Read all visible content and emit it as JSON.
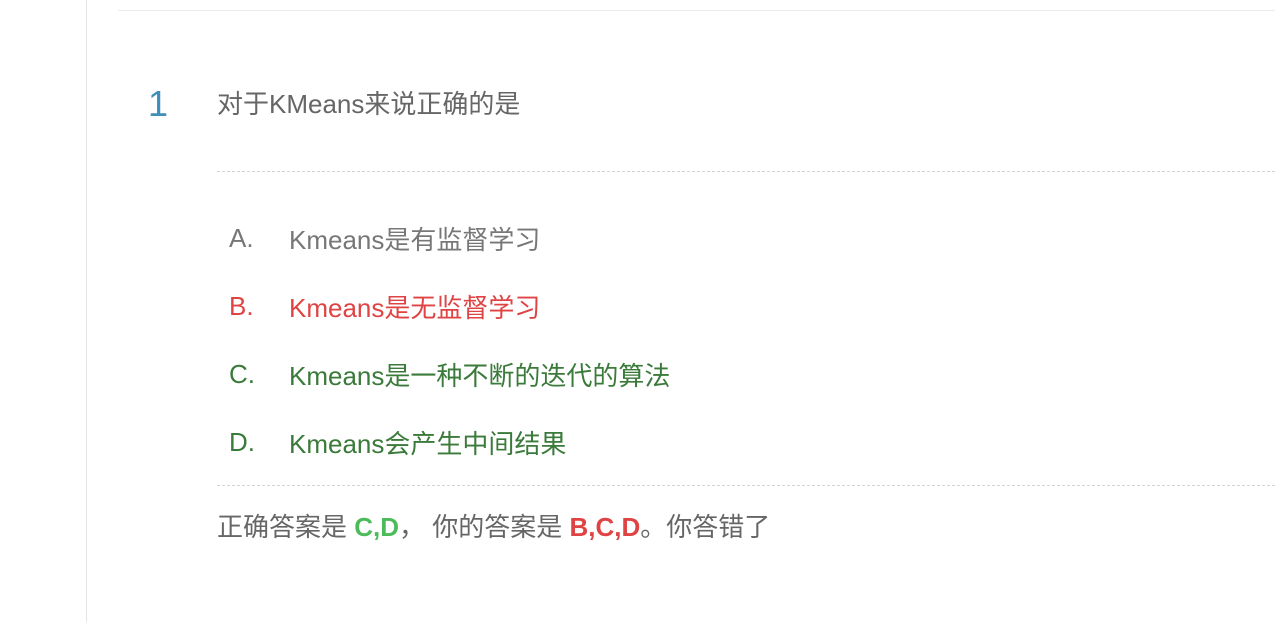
{
  "question": {
    "number": "1",
    "title": "对于KMeans来说正确的是"
  },
  "options": [
    {
      "letter": "A.",
      "text": "Kmeans是有监督学习",
      "status": "neutral"
    },
    {
      "letter": "B.",
      "text": "Kmeans是无监督学习",
      "status": "wrong"
    },
    {
      "letter": "C.",
      "text": "Kmeans是一种不断的迭代的算法",
      "status": "right"
    },
    {
      "letter": "D.",
      "text": "Kmeans会产生中间结果",
      "status": "right"
    }
  ],
  "result": {
    "correct_prefix": "正确答案是 ",
    "correct_answer": "C,D",
    "separator": "，  你的答案是 ",
    "user_answer": "B,C,D",
    "verdict": "。你答错了"
  },
  "colors": {
    "number": "#3d8eb9",
    "neutral": "#777777",
    "wrong": "#e04343",
    "right": "#3a7a3a",
    "correct_answer": "#4cbb5a"
  }
}
